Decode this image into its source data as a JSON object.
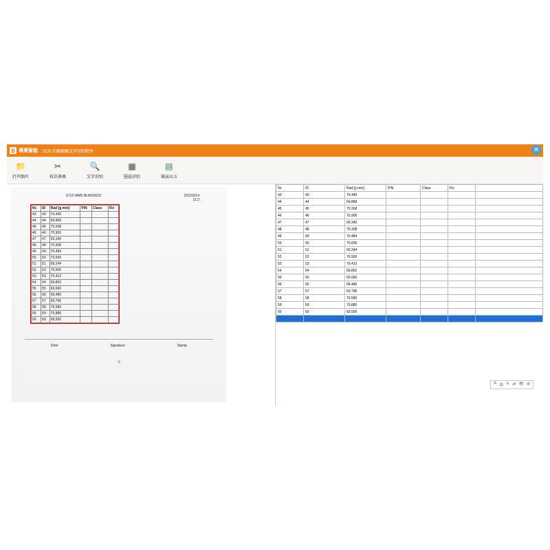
{
  "titlebar": {
    "brand": "博奥智能",
    "app_title": "OCR 扫描图像文字识别软件"
  },
  "toolbar": {
    "btn_open": "打开图片",
    "btn_correct": "校正表格",
    "btn_ocr": "文字识别",
    "btn_area": "圈选识别",
    "btn_export": "输出XLS"
  },
  "scan": {
    "header_left": "5716 WM9 RLWS0020",
    "header_date": "2022/3/14",
    "header_time": "11:2",
    "cols": {
      "c1": "Nr.",
      "c2": "ID",
      "c3": "Rad [g mm]",
      "c4": "P/N",
      "c5": "Class",
      "c6": "Fix"
    },
    "rows": [
      {
        "nr": "43",
        "id": "43",
        "rad": "70,440"
      },
      {
        "nr": "44",
        "id": "44",
        "rad": "69,868"
      },
      {
        "nr": "45",
        "id": "45",
        "rad": "70,268"
      },
      {
        "nr": "46",
        "id": "46",
        "rad": "70,900"
      },
      {
        "nr": "47",
        "id": "47",
        "rad": "69,340"
      },
      {
        "nr": "48",
        "id": "48",
        "rad": "70,308"
      },
      {
        "nr": "49",
        "id": "49",
        "rad": "70,484"
      },
      {
        "nr": "50",
        "id": "50",
        "rad": "70,656"
      },
      {
        "nr": "51",
        "id": "51",
        "rad": "69,244"
      },
      {
        "nr": "52",
        "id": "52",
        "rad": "70,500"
      },
      {
        "nr": "53",
        "id": "53",
        "rad": "70,412"
      },
      {
        "nr": "54",
        "id": "54",
        "rad": "69,852"
      },
      {
        "nr": "55",
        "id": "55",
        "rad": "69,660"
      },
      {
        "nr": "56",
        "id": "56",
        "rad": "69,480"
      },
      {
        "nr": "57",
        "id": "57",
        "rad": "69,796"
      },
      {
        "nr": "58",
        "id": "58",
        "rad": "70,580"
      },
      {
        "nr": "59",
        "id": "59",
        "rad": "70,880"
      },
      {
        "nr": "60",
        "id": "60",
        "rad": "69,500"
      }
    ],
    "footer_date": "Date",
    "footer_sig": "Signature",
    "footer_stamp": "Stamp",
    "page_no": "-1-"
  },
  "result": {
    "cols": {
      "c1": "Nr.",
      "c2": "ID",
      "c3": "Rad [g mm]",
      "c4": "P/N",
      "c5": "Class",
      "c6": "Fix"
    },
    "rows": [
      {
        "nr": "43",
        "id": "43",
        "rad": "70.440"
      },
      {
        "nr": "44",
        "id": "44",
        "rad": "69.868"
      },
      {
        "nr": "45",
        "id": "45",
        "rad": "70.268"
      },
      {
        "nr": "46",
        "id": "46",
        "rad": "70.900"
      },
      {
        "nr": "47",
        "id": "47",
        "rad": "69.340"
      },
      {
        "nr": "48",
        "id": "48",
        "rad": "70.308"
      },
      {
        "nr": "49",
        "id": "49",
        "rad": "70.484"
      },
      {
        "nr": "50",
        "id": "50",
        "rad": "70.656"
      },
      {
        "nr": "51",
        "id": "51",
        "rad": "69.244"
      },
      {
        "nr": "52",
        "id": "52",
        "rad": "70.500"
      },
      {
        "nr": "53",
        "id": "53",
        "rad": "70.412"
      },
      {
        "nr": "54",
        "id": "54",
        "rad": "69.852"
      },
      {
        "nr": "55",
        "id": "55",
        "rad": "69.660"
      },
      {
        "nr": "56",
        "id": "56",
        "rad": "69.480"
      },
      {
        "nr": "57",
        "id": "57",
        "rad": "69.796"
      },
      {
        "nr": "58",
        "id": "58",
        "rad": "70.580"
      },
      {
        "nr": "59",
        "id": "59",
        "rad": "70.880"
      },
      {
        "nr": "60",
        "id": "60",
        "rad": "69.500"
      }
    ]
  },
  "mini_toolbar": {
    "i1": "A",
    "i2": "中",
    "i3": "✎",
    "i4": "⇄",
    "i5": "👁",
    "i6": "⊘"
  }
}
